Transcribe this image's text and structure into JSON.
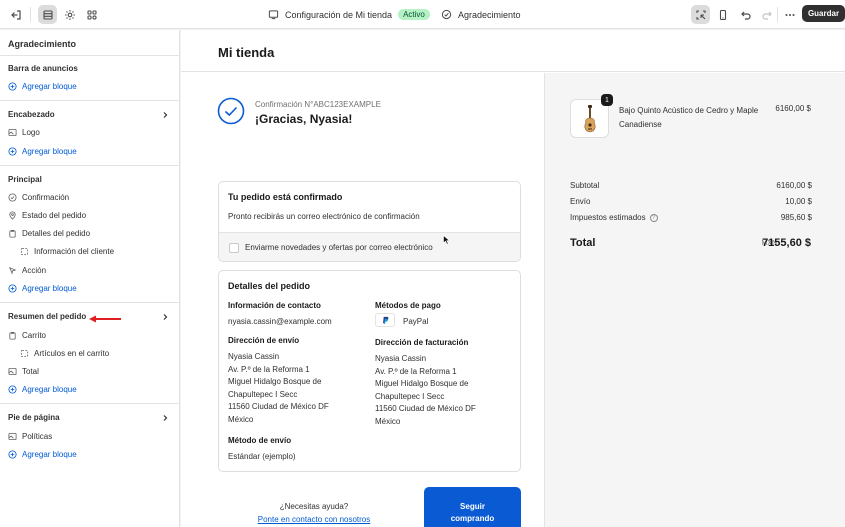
{
  "topbar": {
    "page_name": "Configuración de Mi tienda",
    "status_badge": "Activo",
    "template": "Agradecimiento",
    "save_label": "Guardar"
  },
  "sidebar": {
    "title": "Agradecimiento",
    "add_block": "Agregar bloque",
    "sections": [
      {
        "title": "Barra de anuncios"
      },
      {
        "title": "Encabezado",
        "items": [
          "Logo"
        ]
      },
      {
        "title": "Principal",
        "items": [
          "Confirmación",
          "Estado del pedido",
          "Detalles del pedido",
          "Información del cliente",
          "Acción"
        ]
      },
      {
        "title": "Resumen del pedido",
        "items": [
          "Carrito",
          "Artículos en el carrito",
          "Total"
        ]
      },
      {
        "title": "Pie de página",
        "items": [
          "Políticas"
        ]
      }
    ]
  },
  "store": {
    "name": "Mi tienda"
  },
  "confirmation": {
    "number": "Confirmación N°ABC123EXAMPLE",
    "thanks": "¡Gracias, Nyasia!"
  },
  "confirmed_card": {
    "title": "Tu pedido está confirmado",
    "text": "Pronto recibirás un correo electrónico de confirmación",
    "newsletter": "Enviarme novedades y ofertas por correo electrónico"
  },
  "details_card": {
    "title": "Detalles del pedido",
    "contact_label": "Información de contacto",
    "contact_value": "nyasia.cassin@example.com",
    "payment_label": "Métodos de pago",
    "payment_value": "PayPal",
    "shipping_addr_label": "Dirección de envío",
    "shipping_addr": [
      "Nyasia Cassin",
      "Av. P.º de la Reforma 1",
      "Miguel Hidalgo Bosque de",
      "Chapultepec I Secc",
      "11560 Ciudad de México DF",
      "México"
    ],
    "billing_addr_label": "Dirección de facturación",
    "billing_addr": [
      "Nyasia Cassin",
      "Av. P.º de la Reforma 1",
      "Miguel Hidalgo Bosque de",
      "Chapultepec I Secc",
      "11560 Ciudad de México DF",
      "México"
    ],
    "shipping_method_label": "Método de envío",
    "shipping_method_value": "Estándar (ejemplo)"
  },
  "help": {
    "question": "¿Necesitas ayuda?",
    "link": "Ponte en contacto con nosotros",
    "continue": "Seguir comprando"
  },
  "summary": {
    "qty": "1",
    "product": "Bajo Quinto Acústico de Cedro y Maple Canadiense",
    "product_price": "6160,00 $",
    "subtotal_label": "Subtotal",
    "subtotal": "6160,00 $",
    "shipping_label": "Envío",
    "shipping": "10,00 $",
    "taxes_label": "Impuestos estimados",
    "taxes": "985,60 $",
    "total_label": "Total",
    "currency": "MXN",
    "total": "7155,60 $"
  }
}
